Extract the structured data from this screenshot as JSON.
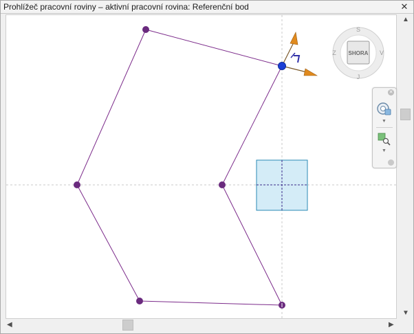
{
  "window": {
    "title": "Prohlížeč pracovní roviny – aktivní pracovní rovina: Referenční bod",
    "close_label": "✕"
  },
  "viewcube": {
    "face_label": "SHORA",
    "compass": {
      "north": "S",
      "south": "J",
      "east": "V",
      "west": "Z"
    }
  },
  "colors": {
    "sketch_line": "#7b2a8a",
    "point": "#6a2a7e",
    "active_point": "#1b3fd6",
    "workplane_fill": "#d4ecf7",
    "workplane_border": "#2a8ab4",
    "axis_arrow": "#e08a1e"
  },
  "icons": {
    "close": "close-icon",
    "scroll_up": "chevron-up-icon",
    "scroll_down": "chevron-down-icon",
    "scroll_left": "chevron-left-icon",
    "scroll_right": "chevron-right-icon",
    "steering_wheel": "steering-wheel-icon",
    "zoom": "zoom-icon"
  }
}
